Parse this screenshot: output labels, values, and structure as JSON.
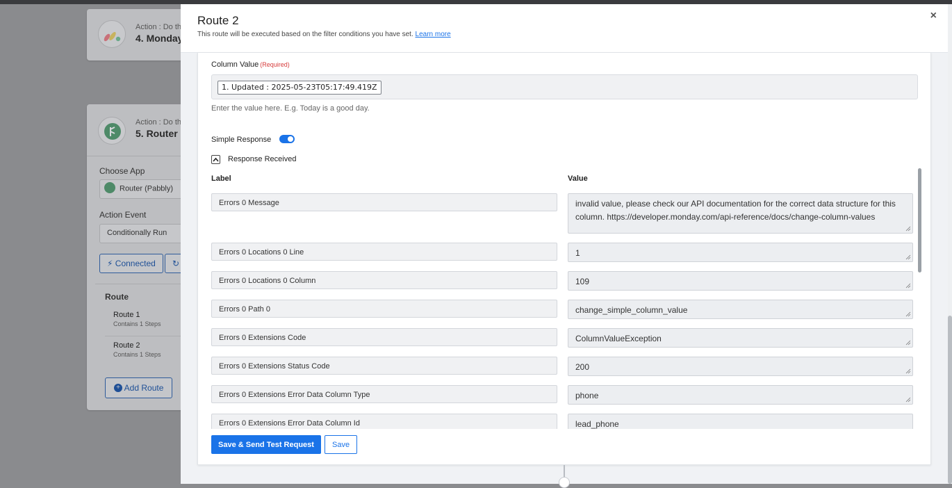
{
  "background": {
    "card1": {
      "action_label": "Action : Do th",
      "title": "4. Monday"
    },
    "card2": {
      "action_label": "Action : Do th",
      "title": "5. Router (",
      "choose_app_label": "Choose App",
      "app_value": "Router (Pabbly)",
      "action_event_label": "Action Event",
      "action_event_value": "Conditionally Run",
      "connected_label": "Connected",
      "route_heading": "Route",
      "routes": [
        {
          "name": "Route 1",
          "steps": "Contains 1 Steps"
        },
        {
          "name": "Route 2",
          "steps": "Contains 1 Steps"
        }
      ],
      "add_route_label": "Add Route"
    }
  },
  "modal": {
    "title": "Route 2",
    "subtitle": "This route will be executed based on the filter conditions you have set.",
    "learn_more": "Learn more",
    "column_value_label": "Column Value",
    "required_tag": "(Required)",
    "column_value_pill": "1. Updated : 2025-05-23T05:17:49.419Z",
    "help_text": "Enter the value here. E.g. Today is a good day.",
    "simple_response_label": "Simple Response",
    "simple_response_on": true,
    "response_received_label": "Response Received",
    "label_header": "Label",
    "value_header": "Value",
    "rows": [
      {
        "label": "Errors 0 Message",
        "value": "invalid value, please check our API documentation for the correct data structure for this column. https://developer.monday.com/api-reference/docs/change-column-values"
      },
      {
        "label": "Errors 0 Locations 0 Line",
        "value": "1"
      },
      {
        "label": "Errors 0 Locations 0 Column",
        "value": "109"
      },
      {
        "label": "Errors 0 Path 0",
        "value": "change_simple_column_value"
      },
      {
        "label": "Errors 0 Extensions Code",
        "value": "ColumnValueException"
      },
      {
        "label": "Errors 0 Extensions Status Code",
        "value": "200"
      },
      {
        "label": "Errors 0 Extensions Error Data Column Type",
        "value": "phone"
      },
      {
        "label": "Errors 0 Extensions Error Data Column Id",
        "value": "lead_phone"
      }
    ],
    "save_send_label": "Save & Send Test Request",
    "save_label": "Save",
    "close_glyph": "×"
  },
  "colors": {
    "accent": "#1a73e8",
    "required": "#d63b3b",
    "monday_red": "#f6465a",
    "monday_yellow": "#ffcb00",
    "monday_green": "#00ca72",
    "router_green": "#1e9a56"
  }
}
